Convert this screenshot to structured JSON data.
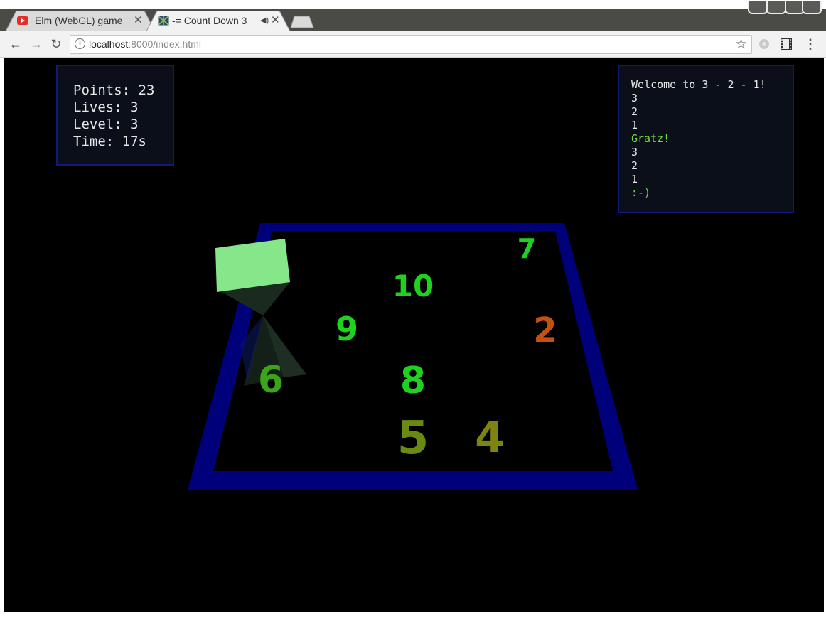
{
  "tabs": [
    {
      "title": "Elm (WebGL) game",
      "favicon": "youtube-icon",
      "active": false
    },
    {
      "title": "-= Count Down 3",
      "favicon": "elm-icon",
      "active": true,
      "audio": true
    }
  ],
  "toolbar": {
    "url_host": "localhost",
    "url_rest": ":8000/index.html"
  },
  "stats": {
    "points": "Points: 23",
    "lives": "Lives: 3",
    "level": "Level: 3",
    "time": "Time: 17s"
  },
  "log": [
    "Welcome to 3 - 2 - 1!",
    "3",
    "2",
    "1",
    "Gratz!",
    "3",
    "2",
    "1",
    ":-)"
  ],
  "board": {
    "numbers": [
      "7",
      "10",
      "9",
      "2",
      "6",
      "8",
      "5",
      "4"
    ],
    "colors": {
      "frame": "#00007a",
      "bright_green": "#1ed21e",
      "olive": "#6b8a12",
      "orange": "#c4520e",
      "cube": "#86e68a"
    }
  }
}
